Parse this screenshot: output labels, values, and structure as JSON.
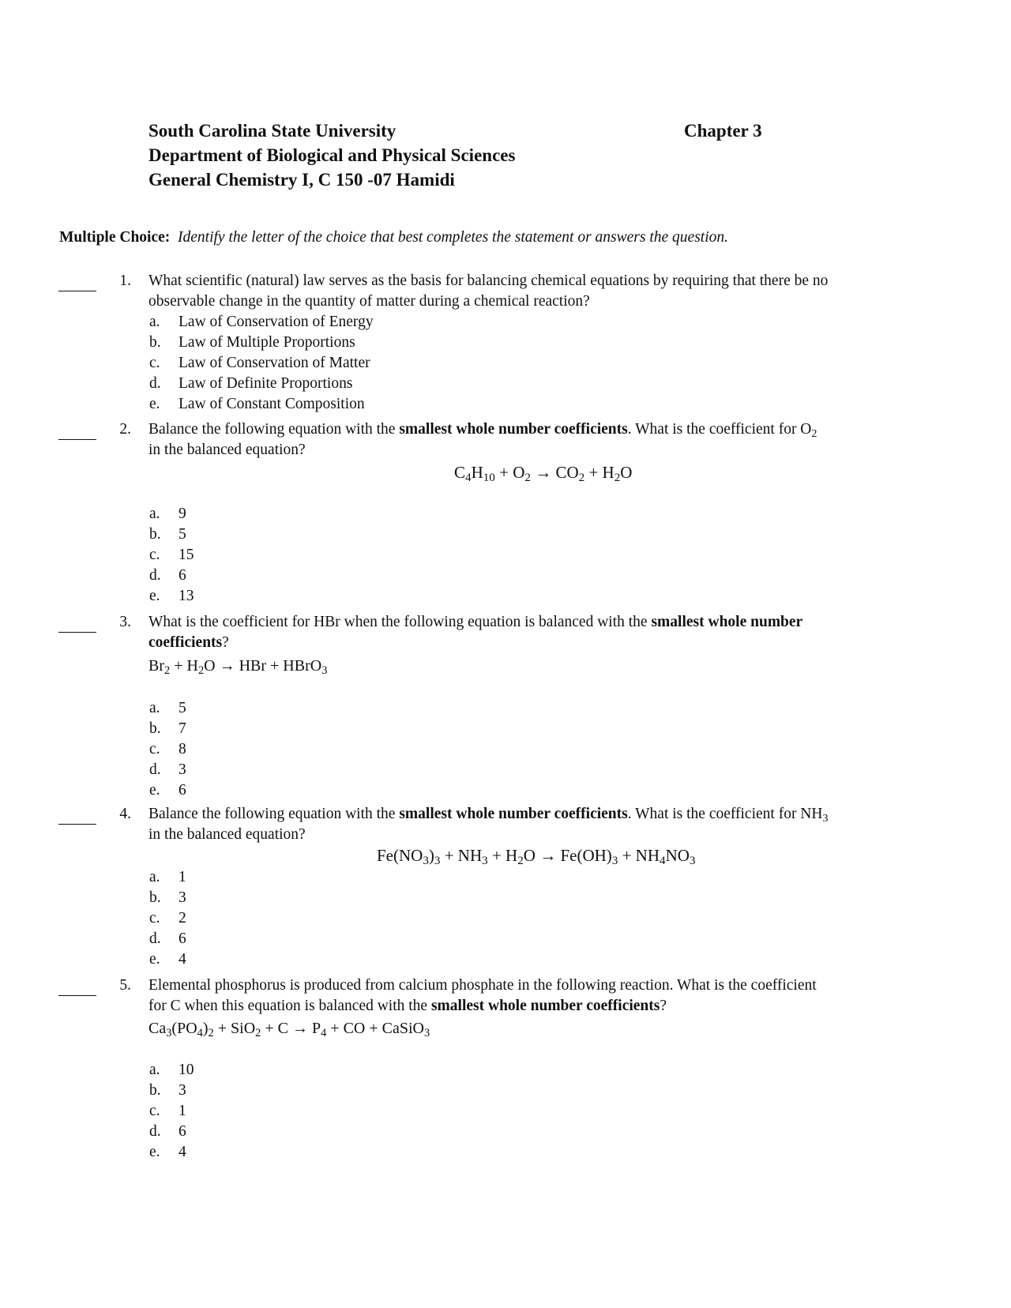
{
  "header": {
    "lines": [
      "South Carolina State University",
      "Department of Biological and Physical Sciences",
      "General Chemistry I, C 150 -07 Hamidi"
    ],
    "chapter": "Chapter 3"
  },
  "instructions": {
    "label": "Multiple Choice:",
    "text": "Identify the letter of the choice that best completes the statement or answers the question."
  },
  "questions": [
    {
      "number": "1.",
      "text_lines": [
        "What scientific (natural) law serves as the basis for balancing chemical equations by requiring that there be no",
        "observable change in the quantity of matter during a chemical reaction?"
      ],
      "options": [
        {
          "letter": "a.",
          "text": "Law of Conservation of Energy"
        },
        {
          "letter": "b.",
          "text": "Law of Multiple Proportions"
        },
        {
          "letter": "c.",
          "text": "Law of Conservation of Matter"
        },
        {
          "letter": "d.",
          "text": "Law of Definite Proportions"
        },
        {
          "letter": "e.",
          "text": "Law of Constant Composition"
        }
      ]
    },
    {
      "number": "2.",
      "text_pre": "Balance the following equation with the ",
      "text_bold": "smallest whole number coefficients",
      "text_post": ". What is the coefficient for O",
      "text_sub": "2",
      "text_line2": "in the balanced equation?",
      "equation": "C4H10 + O2 → CO2 + H2O",
      "options": [
        {
          "letter": "a.",
          "text": "9"
        },
        {
          "letter": "b.",
          "text": "5"
        },
        {
          "letter": "c.",
          "text": "15"
        },
        {
          "letter": "d.",
          "text": "6"
        },
        {
          "letter": "e.",
          "text": "13"
        }
      ]
    },
    {
      "number": "3.",
      "text_pre": "What is the coefficient for HBr when the following equation is balanced with the ",
      "text_bold": "smallest whole number",
      "text_line2_bold": "coefficients",
      "text_line2_post": "?",
      "equation": "Br2 + H2O → HBr + HBrO3",
      "options": [
        {
          "letter": "a.",
          "text": "5"
        },
        {
          "letter": "b.",
          "text": "7"
        },
        {
          "letter": "c.",
          "text": "8"
        },
        {
          "letter": "d.",
          "text": "3"
        },
        {
          "letter": "e.",
          "text": "6"
        }
      ]
    },
    {
      "number": "4.",
      "text_pre": "Balance the following equation with the ",
      "text_bold": "smallest whole number coefficients",
      "text_post": ". What is the coefficient for NH",
      "text_sub": "3",
      "text_line2": "in the balanced equation?",
      "equation": "Fe(NO3)3 + NH3 + H2O → Fe(OH)3 + NH4NO3",
      "options": [
        {
          "letter": "a.",
          "text": "1"
        },
        {
          "letter": "b.",
          "text": "3"
        },
        {
          "letter": "c.",
          "text": "2"
        },
        {
          "letter": "d.",
          "text": "6"
        },
        {
          "letter": "e.",
          "text": "4"
        }
      ]
    },
    {
      "number": "5.",
      "text_line1": "Elemental phosphorus is produced from calcium phosphate in the following reaction. What is the coefficient",
      "text_line2_pre": "for C when this equation is balanced with the ",
      "text_line2_bold": "smallest whole number coefficients",
      "text_line2_post": "?",
      "equation": "Ca3(PO4)2 + SiO2 + C → P4 + CO + CaSiO3",
      "options": [
        {
          "letter": "a.",
          "text": "10"
        },
        {
          "letter": "b.",
          "text": "3"
        },
        {
          "letter": "c.",
          "text": "1"
        },
        {
          "letter": "d.",
          "text": "6"
        },
        {
          "letter": "e.",
          "text": "4"
        }
      ]
    }
  ]
}
